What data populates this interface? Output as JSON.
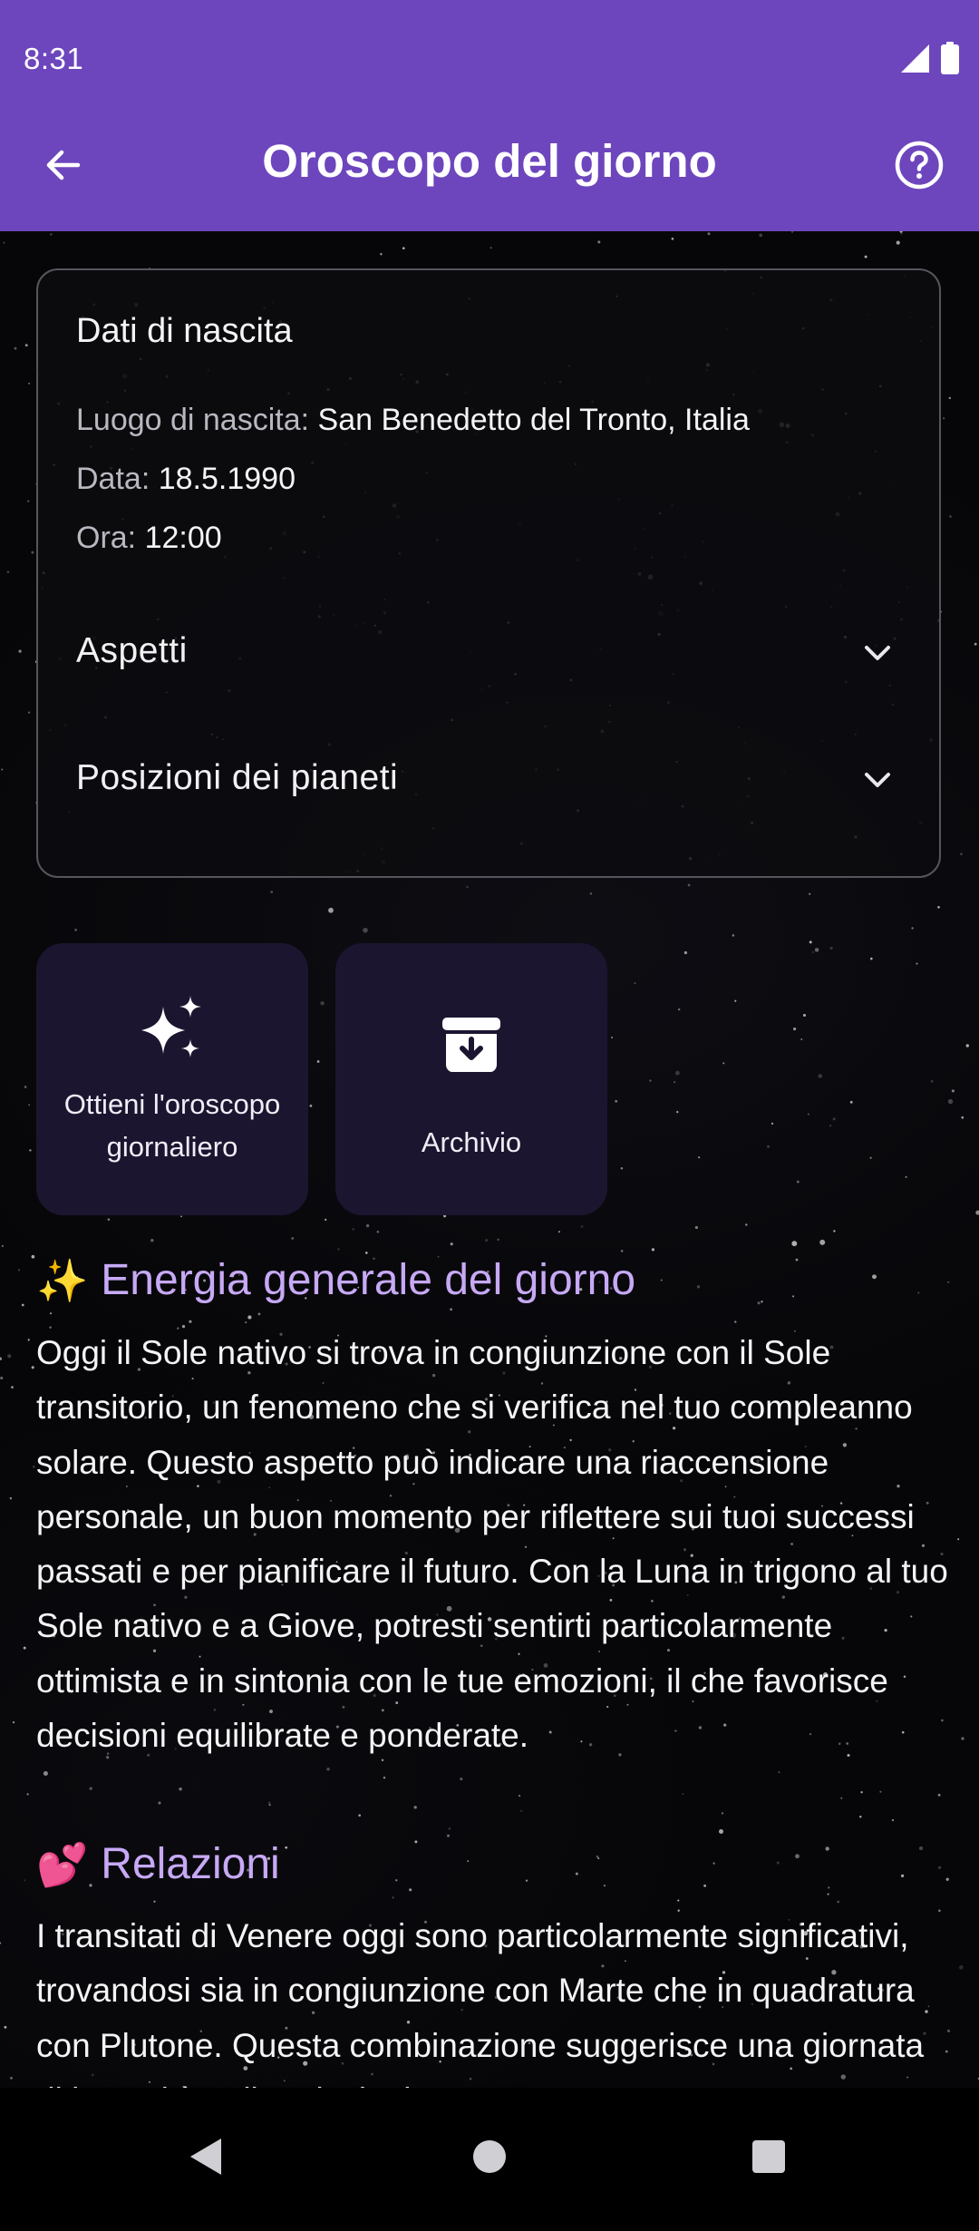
{
  "status_bar": {
    "time": "8:31"
  },
  "app_bar": {
    "title": "Oroscopo del giorno"
  },
  "birth_data": {
    "title": "Dati di nascita",
    "place_label": "Luogo di nascita:",
    "place_value": "San Benedetto del Tronto, Italia",
    "date_label": "Data:",
    "date_value": "18.5.1990",
    "time_label": "Ora:",
    "time_value": "12:00",
    "aspects_label": "Aspetti",
    "planets_label": "Posizioni dei pianeti"
  },
  "actions": {
    "get_daily_line1": "Ottieni l'oroscopo",
    "get_daily_line2": "giornaliero",
    "archive": "Archivio"
  },
  "sections": [
    {
      "emoji": "✨",
      "title": "Energia generale del giorno",
      "text": "Oggi il Sole nativo si trova in congiunzione con il Sole transitorio, un fenomeno che si verifica nel tuo compleanno solare. Questo aspetto può indicare una riaccensione personale, un buon momento per riflettere sui tuoi successi passati e per pianificare il futuro. Con la Luna in trigono al tuo Sole nativo e a Giove, potresti sentirti particolarmente ottimista e in sintonia con le tue emozioni, il che favorisce decisioni equilibrate e ponderate."
    },
    {
      "emoji": "💕",
      "title": "Relazioni",
      "text": "I transitati di Venere oggi sono particolarmente significativi, trovandosi sia in congiunzione con Marte che in quadratura con Plutone. Questa combinazione suggerisce una giornata di intensità nelle relazioni"
    }
  ],
  "icons": {
    "back": "arrow-left-icon",
    "help": "help-circle-icon",
    "expand": "chevron-down-icon",
    "sparkles": "sparkles-icon",
    "archive": "archive-box-icon",
    "signal": "signal-icon",
    "battery": "battery-icon"
  },
  "colors": {
    "app_bar": "#6d46bd",
    "heading_accent": "#c7a9f5",
    "tile_background": "#1c1530",
    "background": "#060608"
  }
}
